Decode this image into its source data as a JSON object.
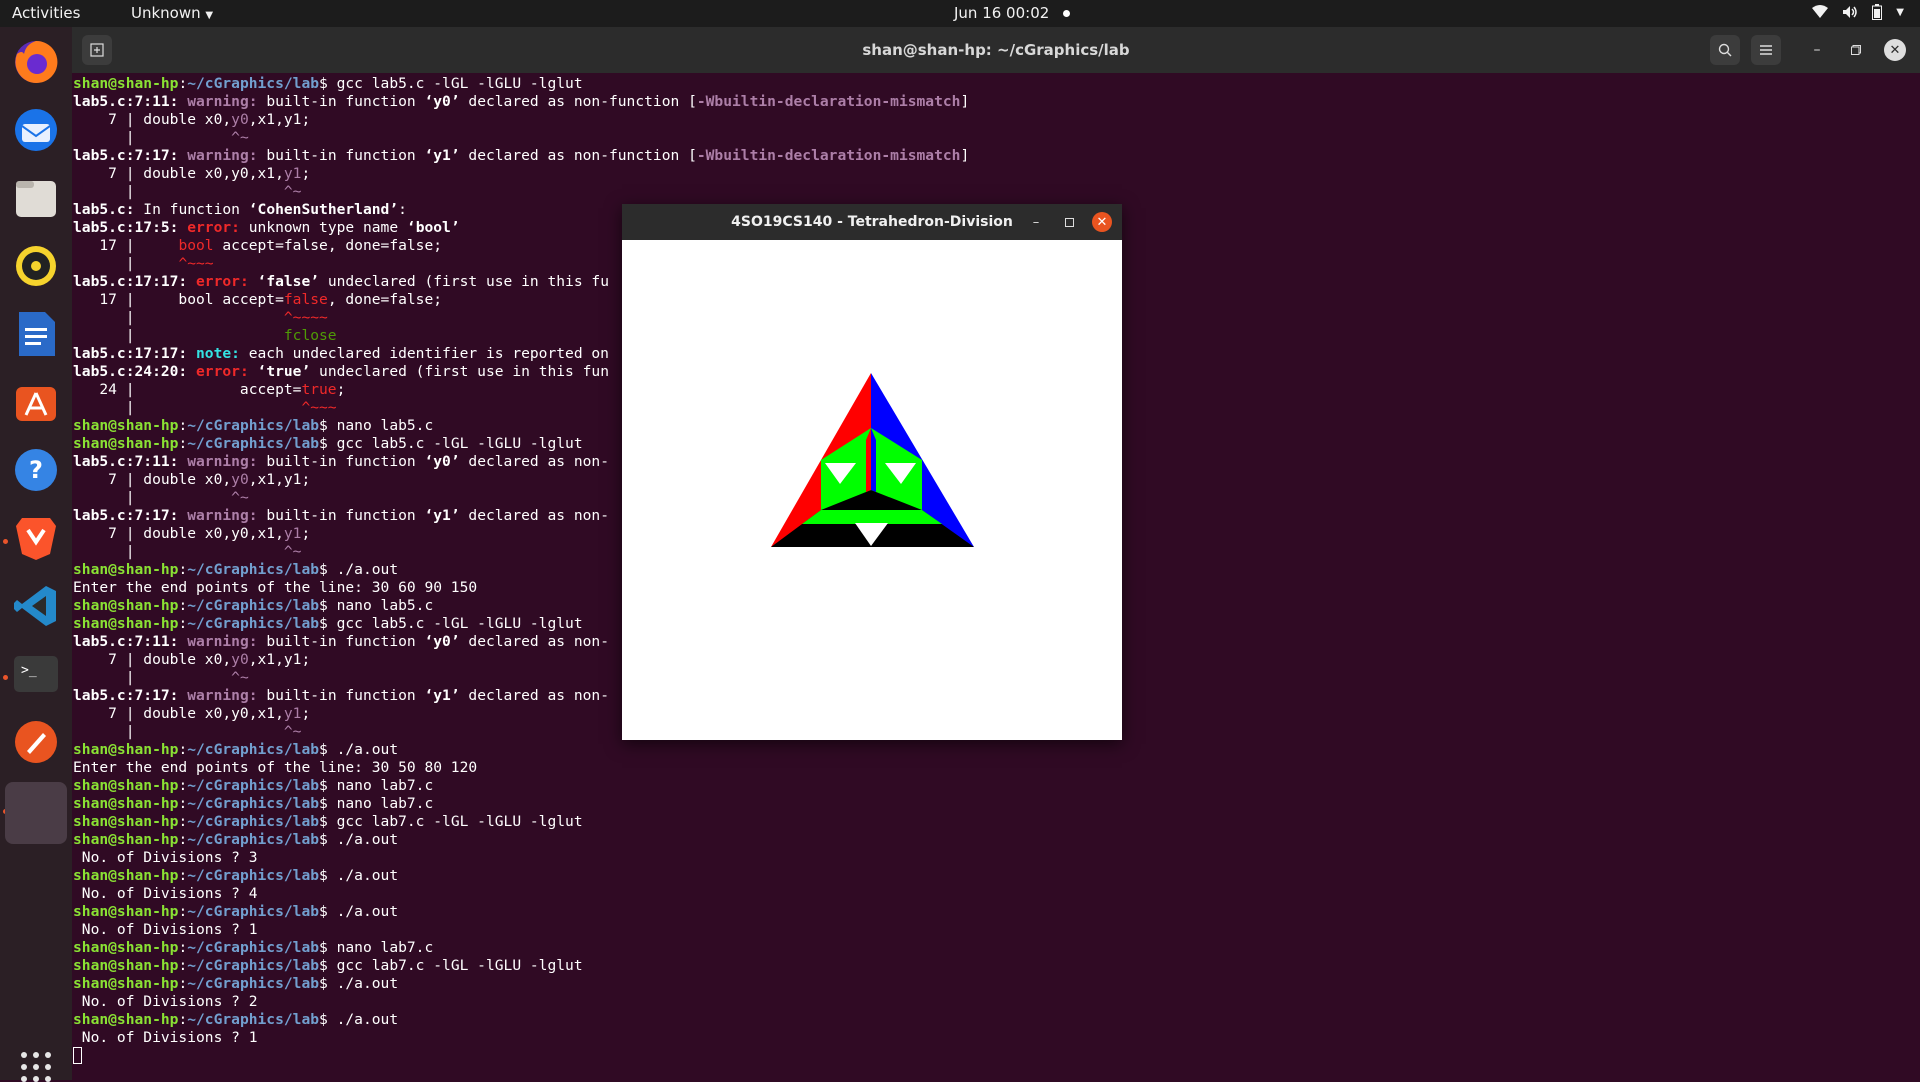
{
  "topbar": {
    "activities": "Activities",
    "app_menu": "Unknown",
    "clock": "Jun 16  00:02"
  },
  "dock": {
    "items": [
      "firefox-icon",
      "thunderbird-icon",
      "files-icon",
      "rhythmbox-icon",
      "writer-icon",
      "software-icon",
      "help-icon",
      "brave-icon",
      "vscode-icon",
      "terminal-icon",
      "drawing-icon",
      "opengl-window-icon"
    ]
  },
  "terminal": {
    "title": "shan@shan-hp: ~/cGraphics/lab",
    "user": "shan@shan-hp",
    "path": "~/cGraphics/lab",
    "lines": [
      [
        {
          "t": "shan@shan-hp",
          "c": "pu"
        },
        {
          "t": ":"
        },
        {
          "t": "~/cGraphics/lab",
          "c": "pp"
        },
        {
          "t": "$ gcc lab5.c -lGL -lGLU -lglut"
        }
      ],
      [
        {
          "t": "lab5.c:7:11: ",
          "c": "b"
        },
        {
          "t": "warning: ",
          "c": "warn"
        },
        {
          "t": "built-in function "
        },
        {
          "t": "‘y0’",
          "c": "b"
        },
        {
          "t": " declared as non-function ["
        },
        {
          "t": "-Wbuiltin-declaration-mismatch",
          "c": "warn"
        },
        {
          "t": "]"
        }
      ],
      [
        {
          "t": "    7 | double x0,"
        },
        {
          "t": "y0",
          "c": "mwarn"
        },
        {
          "t": ",x1,y1;"
        }
      ],
      [
        {
          "t": "      |           "
        },
        {
          "t": "^~",
          "c": "mwarn"
        }
      ],
      [
        {
          "t": "lab5.c:7:17: ",
          "c": "b"
        },
        {
          "t": "warning: ",
          "c": "warn"
        },
        {
          "t": "built-in function "
        },
        {
          "t": "‘y1’",
          "c": "b"
        },
        {
          "t": " declared as non-function ["
        },
        {
          "t": "-Wbuiltin-declaration-mismatch",
          "c": "warn"
        },
        {
          "t": "]"
        }
      ],
      [
        {
          "t": "    7 | double x0,y0,x1,"
        },
        {
          "t": "y1",
          "c": "mwarn"
        },
        {
          "t": ";"
        }
      ],
      [
        {
          "t": "      |                 "
        },
        {
          "t": "^~",
          "c": "mwarn"
        }
      ],
      [
        {
          "t": "lab5.c:",
          "c": "b"
        },
        {
          "t": " In function "
        },
        {
          "t": "‘CohenSutherland’",
          "c": "b"
        },
        {
          "t": ":"
        }
      ],
      [
        {
          "t": "lab5.c:17:5: ",
          "c": "b"
        },
        {
          "t": "error: ",
          "c": "err"
        },
        {
          "t": "unknown type name "
        },
        {
          "t": "‘bool’",
          "c": "b"
        }
      ],
      [
        {
          "t": "   17 |     "
        },
        {
          "t": "bool",
          "c": "merr"
        },
        {
          "t": " accept=false, done=false;"
        }
      ],
      [
        {
          "t": "      |     "
        },
        {
          "t": "^~~~",
          "c": "merr"
        }
      ],
      [
        {
          "t": "lab5.c:17:17: ",
          "c": "b"
        },
        {
          "t": "error: ",
          "c": "err"
        },
        {
          "t": "‘false’",
          "c": "b"
        },
        {
          "t": " undeclared (first use in this fu"
        }
      ],
      [
        {
          "t": "   17 |     bool accept="
        },
        {
          "t": "false",
          "c": "merr"
        },
        {
          "t": ", done=false;"
        }
      ],
      [
        {
          "t": "      |                 "
        },
        {
          "t": "^~~~~",
          "c": "merr"
        }
      ],
      [
        {
          "t": "      |                 "
        },
        {
          "t": "fclose",
          "c": "fix"
        }
      ],
      [
        {
          "t": "lab5.c:17:17: ",
          "c": "b"
        },
        {
          "t": "note: ",
          "c": "note"
        },
        {
          "t": "each undeclared identifier is reported on"
        }
      ],
      [
        {
          "t": "lab5.c:24:20: ",
          "c": "b"
        },
        {
          "t": "error: ",
          "c": "err"
        },
        {
          "t": "‘true’",
          "c": "b"
        },
        {
          "t": " undeclared (first use in this fun"
        }
      ],
      [
        {
          "t": "   24 |            accept="
        },
        {
          "t": "true",
          "c": "merr"
        },
        {
          "t": ";"
        }
      ],
      [
        {
          "t": "      |                   "
        },
        {
          "t": "^~~~",
          "c": "merr"
        }
      ],
      [
        {
          "t": "shan@shan-hp",
          "c": "pu"
        },
        {
          "t": ":"
        },
        {
          "t": "~/cGraphics/lab",
          "c": "pp"
        },
        {
          "t": "$ nano lab5.c"
        }
      ],
      [
        {
          "t": "shan@shan-hp",
          "c": "pu"
        },
        {
          "t": ":"
        },
        {
          "t": "~/cGraphics/lab",
          "c": "pp"
        },
        {
          "t": "$ gcc lab5.c -lGL -lGLU -lglut"
        }
      ],
      [
        {
          "t": "lab5.c:7:11: ",
          "c": "b"
        },
        {
          "t": "warning: ",
          "c": "warn"
        },
        {
          "t": "built-in function "
        },
        {
          "t": "‘y0’",
          "c": "b"
        },
        {
          "t": " declared as non-"
        }
      ],
      [
        {
          "t": "    7 | double x0,"
        },
        {
          "t": "y0",
          "c": "mwarn"
        },
        {
          "t": ",x1,y1;"
        }
      ],
      [
        {
          "t": "      |           "
        },
        {
          "t": "^~",
          "c": "mwarn"
        }
      ],
      [
        {
          "t": "lab5.c:7:17: ",
          "c": "b"
        },
        {
          "t": "warning: ",
          "c": "warn"
        },
        {
          "t": "built-in function "
        },
        {
          "t": "‘y1’",
          "c": "b"
        },
        {
          "t": " declared as non-"
        }
      ],
      [
        {
          "t": "    7 | double x0,y0,x1,"
        },
        {
          "t": "y1",
          "c": "mwarn"
        },
        {
          "t": ";"
        }
      ],
      [
        {
          "t": "      |                 "
        },
        {
          "t": "^~",
          "c": "mwarn"
        }
      ],
      [
        {
          "t": "shan@shan-hp",
          "c": "pu"
        },
        {
          "t": ":"
        },
        {
          "t": "~/cGraphics/lab",
          "c": "pp"
        },
        {
          "t": "$ ./a.out"
        }
      ],
      [
        {
          "t": "Enter the end points of the line: 30 60 90 150"
        }
      ],
      [
        {
          "t": "shan@shan-hp",
          "c": "pu"
        },
        {
          "t": ":"
        },
        {
          "t": "~/cGraphics/lab",
          "c": "pp"
        },
        {
          "t": "$ nano lab5.c"
        }
      ],
      [
        {
          "t": "shan@shan-hp",
          "c": "pu"
        },
        {
          "t": ":"
        },
        {
          "t": "~/cGraphics/lab",
          "c": "pp"
        },
        {
          "t": "$ gcc lab5.c -lGL -lGLU -lglut"
        }
      ],
      [
        {
          "t": "lab5.c:7:11: ",
          "c": "b"
        },
        {
          "t": "warning: ",
          "c": "warn"
        },
        {
          "t": "built-in function "
        },
        {
          "t": "‘y0’",
          "c": "b"
        },
        {
          "t": " declared as non-"
        }
      ],
      [
        {
          "t": "    7 | double x0,"
        },
        {
          "t": "y0",
          "c": "mwarn"
        },
        {
          "t": ",x1,y1;"
        }
      ],
      [
        {
          "t": "      |           "
        },
        {
          "t": "^~",
          "c": "mwarn"
        }
      ],
      [
        {
          "t": "lab5.c:7:17: ",
          "c": "b"
        },
        {
          "t": "warning: ",
          "c": "warn"
        },
        {
          "t": "built-in function "
        },
        {
          "t": "‘y1’",
          "c": "b"
        },
        {
          "t": " declared as non-"
        }
      ],
      [
        {
          "t": "    7 | double x0,y0,x1,"
        },
        {
          "t": "y1",
          "c": "mwarn"
        },
        {
          "t": ";"
        }
      ],
      [
        {
          "t": "      |                 "
        },
        {
          "t": "^~",
          "c": "mwarn"
        }
      ],
      [
        {
          "t": "shan@shan-hp",
          "c": "pu"
        },
        {
          "t": ":"
        },
        {
          "t": "~/cGraphics/lab",
          "c": "pp"
        },
        {
          "t": "$ ./a.out"
        }
      ],
      [
        {
          "t": "Enter the end points of the line: 30 50 80 120"
        }
      ],
      [
        {
          "t": "shan@shan-hp",
          "c": "pu"
        },
        {
          "t": ":"
        },
        {
          "t": "~/cGraphics/lab",
          "c": "pp"
        },
        {
          "t": "$ nano lab7.c"
        }
      ],
      [
        {
          "t": "shan@shan-hp",
          "c": "pu"
        },
        {
          "t": ":"
        },
        {
          "t": "~/cGraphics/lab",
          "c": "pp"
        },
        {
          "t": "$ nano lab7.c"
        }
      ],
      [
        {
          "t": "shan@shan-hp",
          "c": "pu"
        },
        {
          "t": ":"
        },
        {
          "t": "~/cGraphics/lab",
          "c": "pp"
        },
        {
          "t": "$ gcc lab7.c -lGL -lGLU -lglut"
        }
      ],
      [
        {
          "t": "shan@shan-hp",
          "c": "pu"
        },
        {
          "t": ":"
        },
        {
          "t": "~/cGraphics/lab",
          "c": "pp"
        },
        {
          "t": "$ ./a.out"
        }
      ],
      [
        {
          "t": " No. of Divisions ? 3"
        }
      ],
      [
        {
          "t": "shan@shan-hp",
          "c": "pu"
        },
        {
          "t": ":"
        },
        {
          "t": "~/cGraphics/lab",
          "c": "pp"
        },
        {
          "t": "$ ./a.out"
        }
      ],
      [
        {
          "t": " No. of Divisions ? 4"
        }
      ],
      [
        {
          "t": "shan@shan-hp",
          "c": "pu"
        },
        {
          "t": ":"
        },
        {
          "t": "~/cGraphics/lab",
          "c": "pp"
        },
        {
          "t": "$ ./a.out"
        }
      ],
      [
        {
          "t": " No. of Divisions ? 1"
        }
      ],
      [
        {
          "t": "shan@shan-hp",
          "c": "pu"
        },
        {
          "t": ":"
        },
        {
          "t": "~/cGraphics/lab",
          "c": "pp"
        },
        {
          "t": "$ nano lab7.c"
        }
      ],
      [
        {
          "t": "shan@shan-hp",
          "c": "pu"
        },
        {
          "t": ":"
        },
        {
          "t": "~/cGraphics/lab",
          "c": "pp"
        },
        {
          "t": "$ gcc lab7.c -lGL -lGLU -lglut"
        }
      ],
      [
        {
          "t": "shan@shan-hp",
          "c": "pu"
        },
        {
          "t": ":"
        },
        {
          "t": "~/cGraphics/lab",
          "c": "pp"
        },
        {
          "t": "$ ./a.out"
        }
      ],
      [
        {
          "t": " No. of Divisions ? 2"
        }
      ],
      [
        {
          "t": "shan@shan-hp",
          "c": "pu"
        },
        {
          "t": ":"
        },
        {
          "t": "~/cGraphics/lab",
          "c": "pp"
        },
        {
          "t": "$ ./a.out"
        }
      ],
      [
        {
          "t": " No. of Divisions ? 1"
        }
      ]
    ]
  },
  "gl_window": {
    "title": "4SO19CS140 - Tetrahedron-Division",
    "colors": {
      "red": "#ff0000",
      "blue": "#0000ff",
      "green": "#00ff00",
      "black": "#000000",
      "white": "#ffffff"
    }
  },
  "colors": {
    "terminal_bg": "#300a24",
    "prompt_user": "#8ae234",
    "prompt_path": "#729fcf",
    "warning": "#ad7fa8",
    "error": "#ef2929",
    "note": "#34e2e2",
    "accent": "#e95420"
  }
}
